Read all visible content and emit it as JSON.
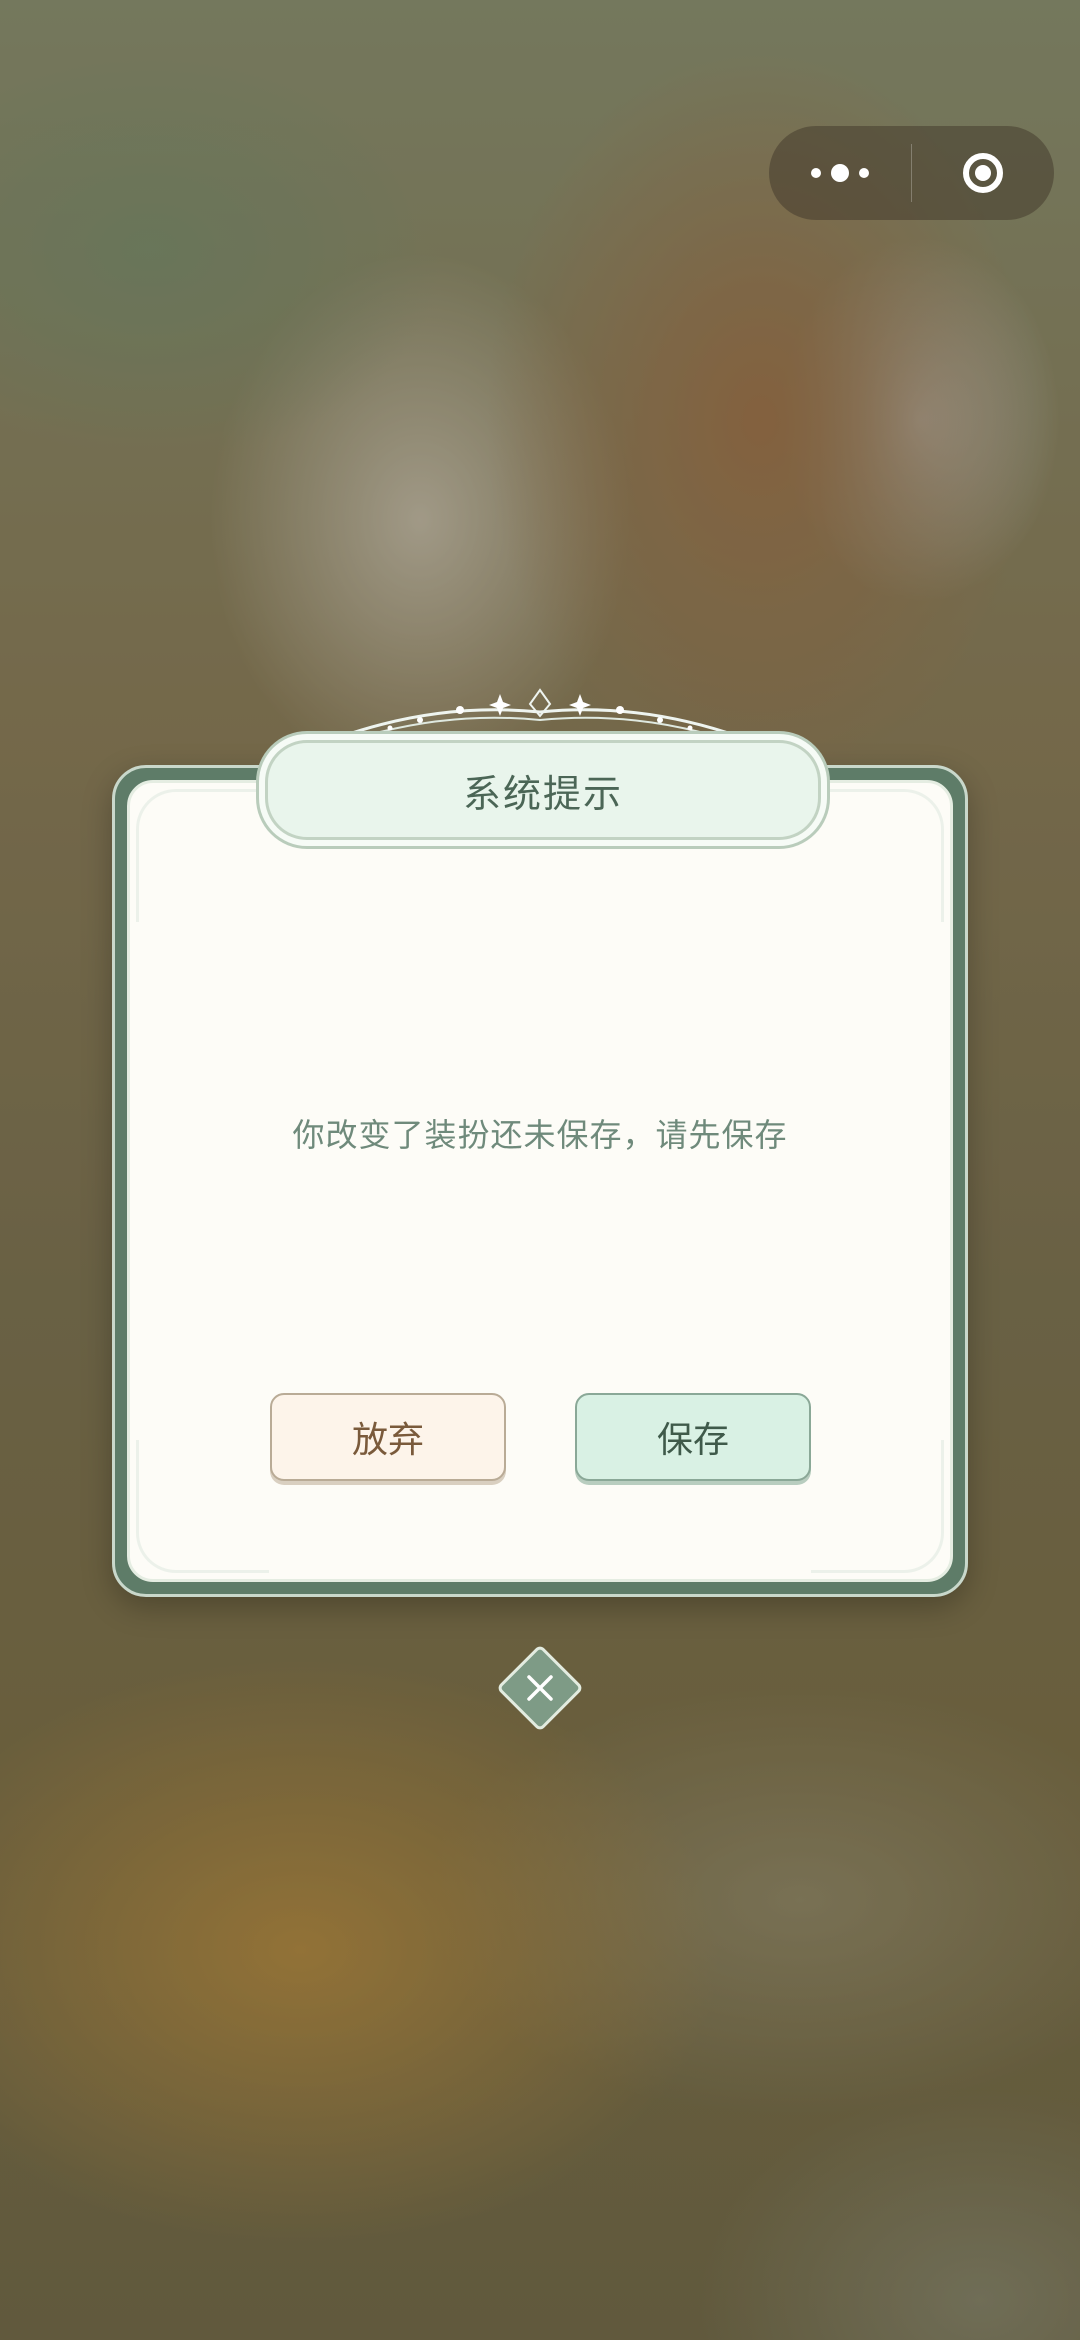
{
  "dialog": {
    "title": "系统提示",
    "message": "你改变了装扮还未保存，请先保存",
    "discard_label": "放弃",
    "save_label": "保存"
  },
  "capsule": {
    "more_icon": "more-dots-icon",
    "close_icon": "target-close-icon"
  },
  "close_icon": "close-x-icon",
  "colors": {
    "dialog_frame": "#5e7c68",
    "dialog_bg": "#fdfcf7",
    "title_plate": "#e9f5ec",
    "discard_bg": "#fdf4ea",
    "save_bg": "#d9f1e4",
    "text_green": "#6f8a7b"
  }
}
